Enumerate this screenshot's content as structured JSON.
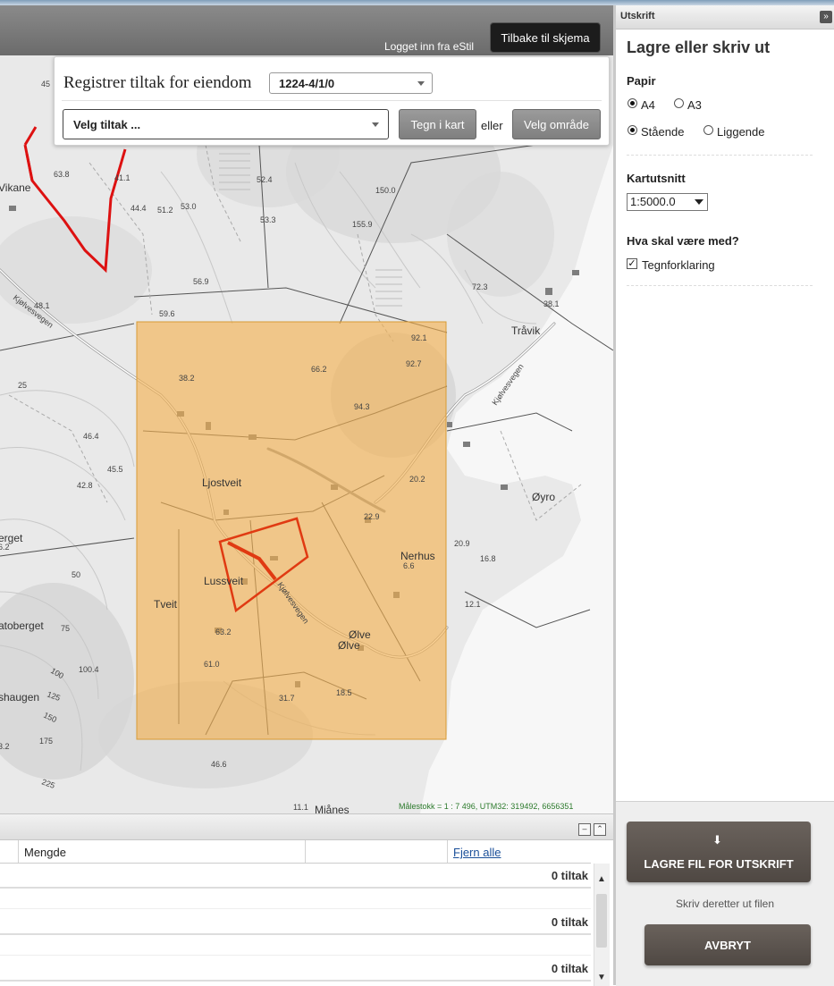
{
  "header": {
    "logged_in": "Logget inn fra eStil",
    "back_button": "Tilbake til skjema"
  },
  "register": {
    "title": "Registrer tiltak for eiendom",
    "property_value": "1224-4/1/0",
    "tiltak_placeholder": "Velg tiltak ...",
    "draw_button": "Tegn i kart",
    "or_text": "eller",
    "area_button": "Velg område"
  },
  "map": {
    "places": [
      "Vikane",
      "Tråvik",
      "Ljostveit",
      "Øyro",
      "erget",
      "Nerhus",
      "Lussveit",
      "Tveit",
      "atoberget",
      "Ølve",
      "Ølve",
      "shaugen",
      "Mjånes"
    ],
    "road_labels": [
      "Kjølvesvegen",
      "Kjølvesvegen",
      "Kjølvesvegen"
    ],
    "elevations": [
      "45",
      "63.8",
      "41.1",
      "52.4",
      "150.0",
      "44.4",
      "51.2",
      "53.0",
      "53.3",
      "155.9",
      "72.3",
      "48.1",
      "56.9",
      "59.6",
      "38.1",
      "92.1",
      "92.7",
      "38.2",
      "66.2",
      "94.3",
      "25",
      "46.4",
      "45.5",
      "42.8",
      "20.2",
      "22.9",
      "6.2",
      "50",
      "20.9",
      "16.8",
      "6.6",
      "12.1",
      "75",
      "63.2",
      "61.0",
      "100",
      "100.4",
      "125",
      "150",
      "175",
      "31.7",
      "18.5",
      "3.2",
      "46.6",
      "225",
      "11.1"
    ],
    "scale_text": "Målestokk = 1 : 7 496, UTM32: 319492, 6656351"
  },
  "print_panel": {
    "panel_title": "Utskrift",
    "collapse_icon": "»",
    "heading": "Lagre eller skriv ut",
    "paper_label": "Papir",
    "paper_options": [
      "A4",
      "A3"
    ],
    "paper_selected": "A4",
    "orientation_options": [
      "Stående",
      "Liggende"
    ],
    "orientation_selected": "Stående",
    "extent_label": "Kartutsnitt",
    "scale_value": "1:5000.0",
    "include_label": "Hva skal være med?",
    "legend_label": "Tegnforklaring",
    "legend_checked": true,
    "save_button": "LAGRE FIL FOR UTSKRIFT",
    "note": "Skriv deretter ut filen",
    "cancel_button": "AVBRYT"
  },
  "grid": {
    "column_amount": "Mengde",
    "remove_all": "Fjern alle",
    "rows": [
      {
        "count": "0 tiltak"
      },
      {
        "count": "0 tiltak"
      },
      {
        "count": "0 tiltak"
      }
    ]
  },
  "colors": {
    "selection_fill": "#f3b04d",
    "property_outline": "#e03a12",
    "boundary_red": "#dd1111",
    "button_dark": "#1c1c1c",
    "button_gray": "#8c8c8c",
    "print_button": "#5c544e"
  }
}
